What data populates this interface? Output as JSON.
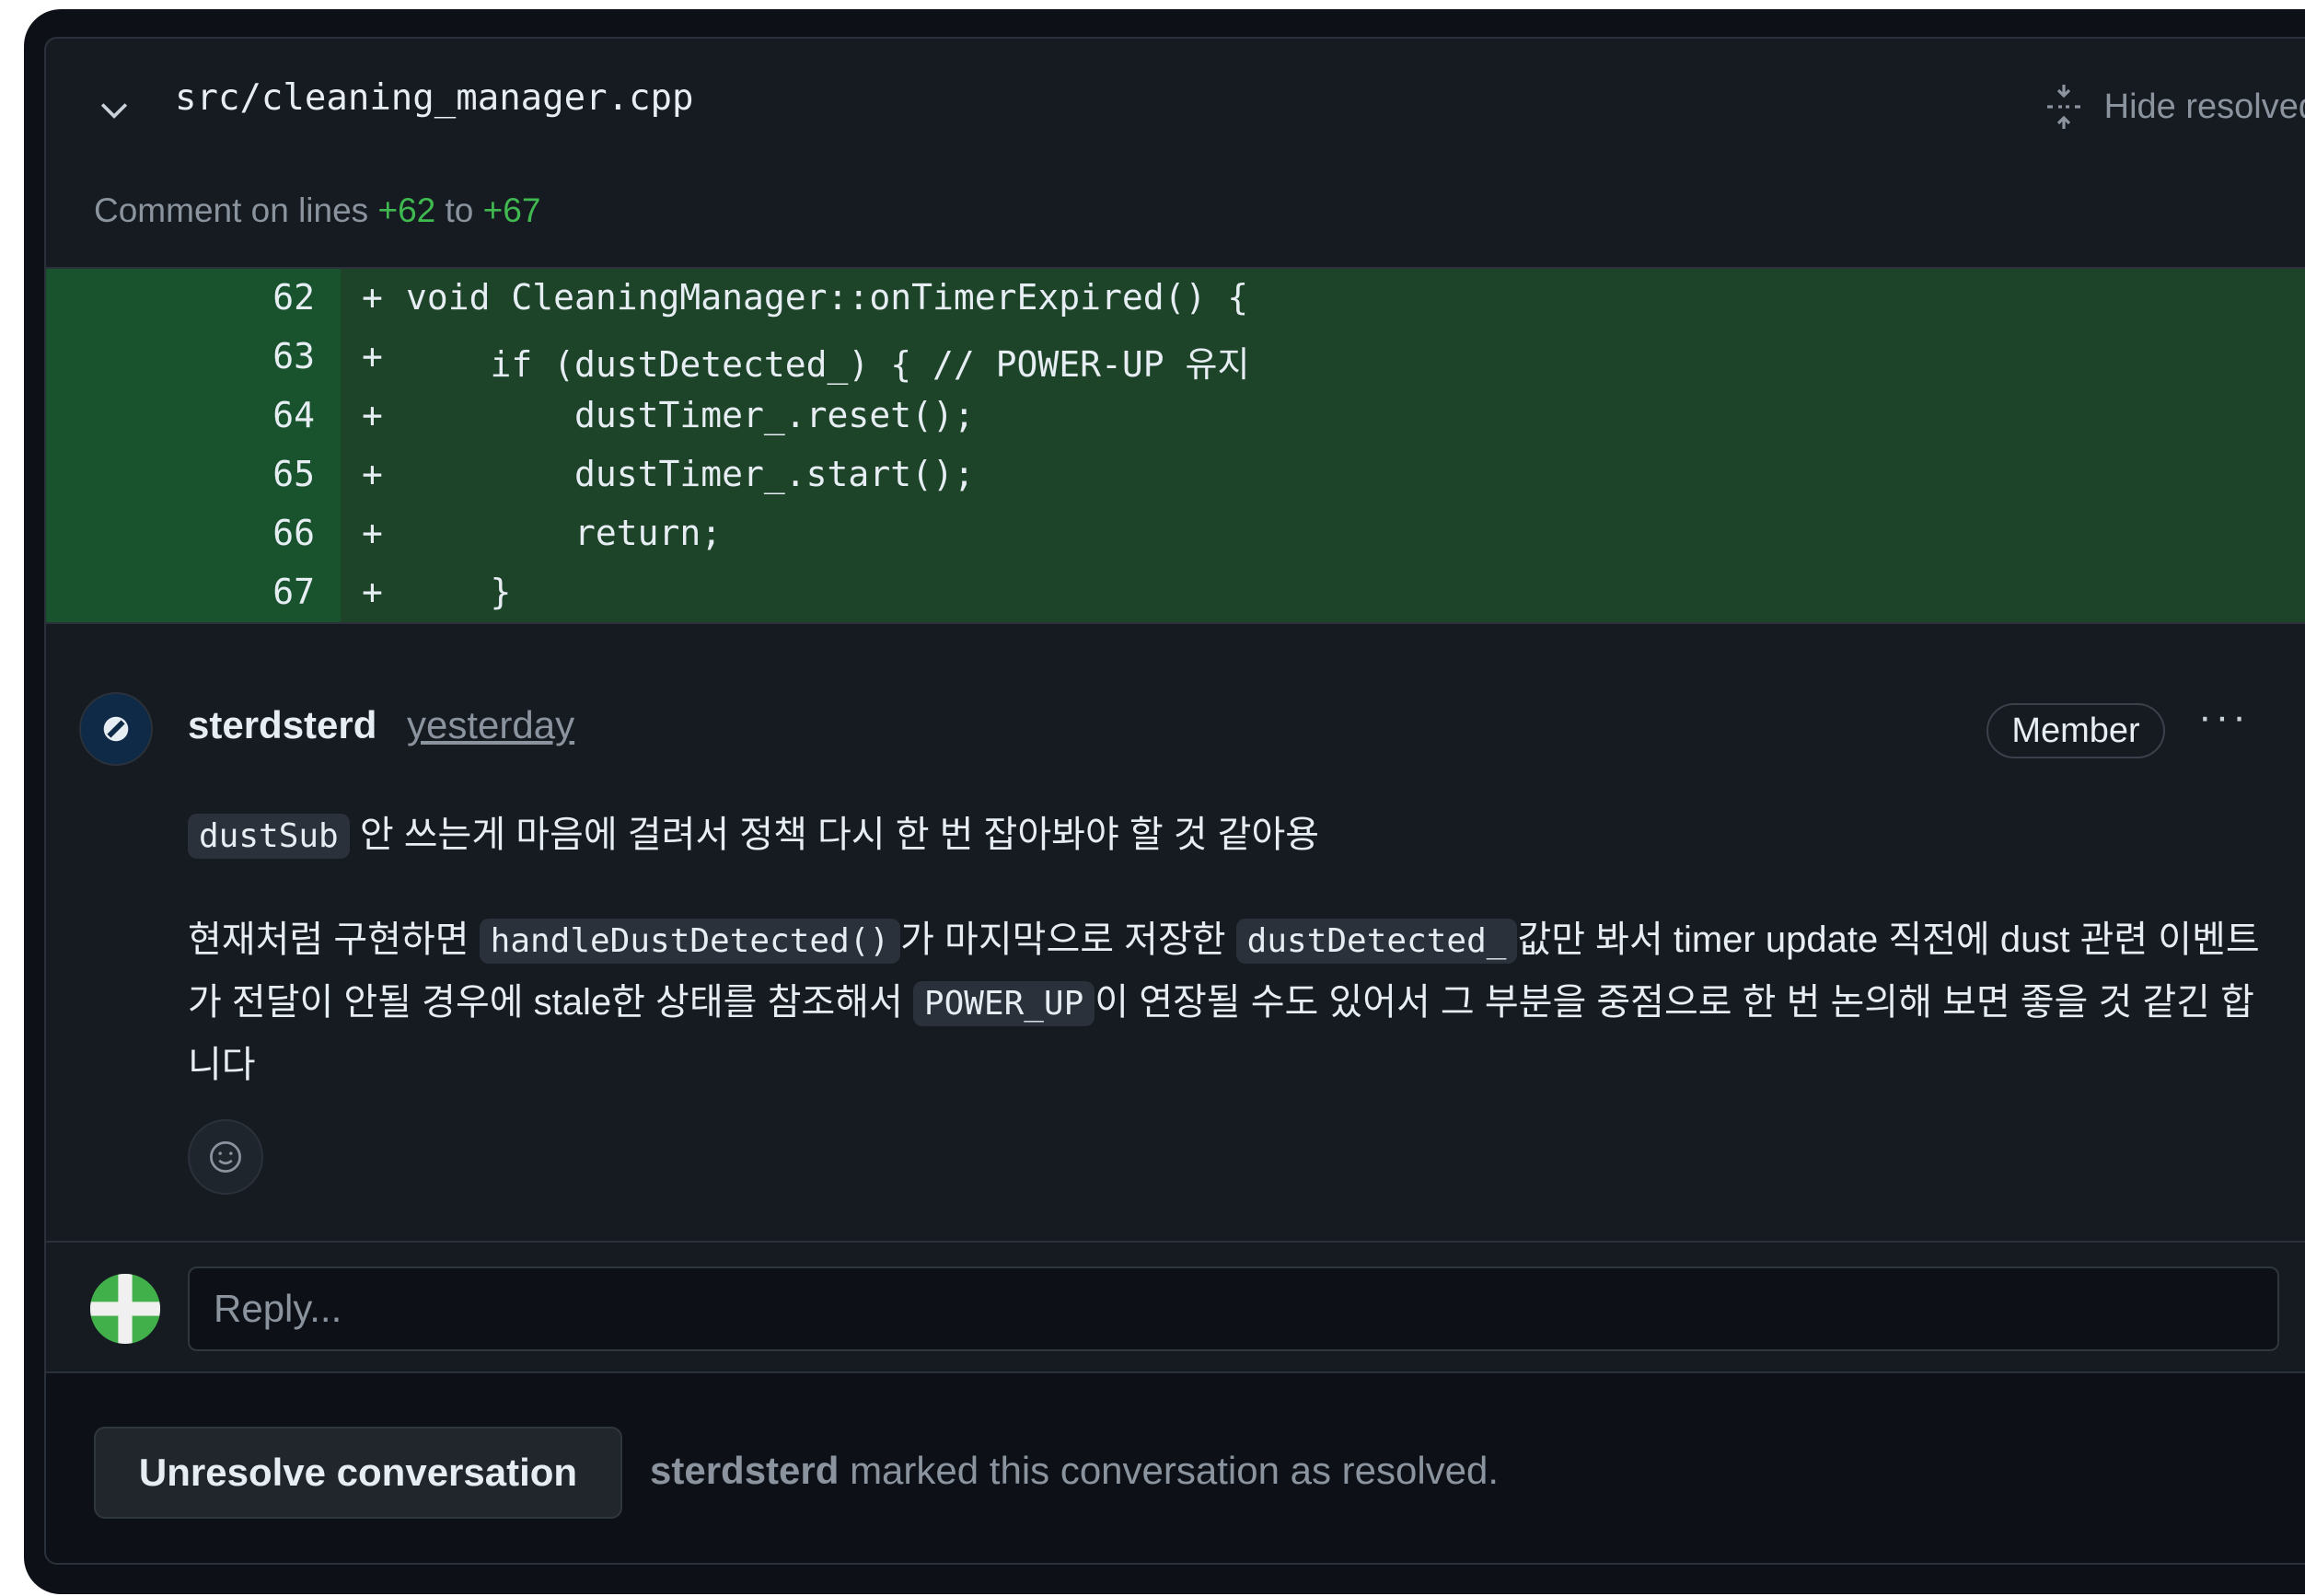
{
  "header": {
    "file_path": "src/cleaning_manager.cpp",
    "hide_resolved_label": "Hide resolved"
  },
  "lines_note": {
    "prefix": "Comment on lines ",
    "start": "+62",
    "middle": " to ",
    "end": "+67"
  },
  "diff": {
    "rows": [
      {
        "line": "62",
        "sign": "+",
        "code": "void CleaningManager::onTimerExpired() {"
      },
      {
        "line": "63",
        "sign": "+",
        "code": "    if (dustDetected_) { // POWER-UP 유지"
      },
      {
        "line": "64",
        "sign": "+",
        "code": "        dustTimer_.reset();"
      },
      {
        "line": "65",
        "sign": "+",
        "code": "        dustTimer_.start();"
      },
      {
        "line": "66",
        "sign": "+",
        "code": "        return;"
      },
      {
        "line": "67",
        "sign": "+",
        "code": "    }"
      }
    ]
  },
  "comment": {
    "author": "sterdsterd",
    "time": "yesterday",
    "role_badge": "Member",
    "more_label": "···",
    "para1_code": "dustSub",
    "para1_text": " 안 쓰는게 마음에 걸려서 정책 다시 한 번 잡아봐야 할 것 같아용",
    "para2_t1": "현재처럼 구현하면 ",
    "para2_c1": "handleDustDetected()",
    "para2_t2": "가 마지막으로 저장한 ",
    "para2_c2": "dustDetected_",
    "para2_t3": "값만 봐서 timer update 직전에 dust 관련 이벤트가 전달이 안될 경우에 stale한 상태를 참조해서 ",
    "para2_c3": "POWER_UP",
    "para2_t4": "이 연장될 수도 있어서 그 부분을 중점으로 한 번 논의해 보면 좋을 것 같긴 합니다"
  },
  "reply": {
    "placeholder": "Reply..."
  },
  "footer": {
    "unresolve_label": "Unresolve conversation",
    "resolver": "sterdsterd",
    "resolved_text": " marked this conversation as resolved."
  },
  "colors": {
    "background": "#161b22",
    "diff_added": "#1d4428",
    "accent_green": "#3fb950",
    "muted": "#8b949e"
  }
}
